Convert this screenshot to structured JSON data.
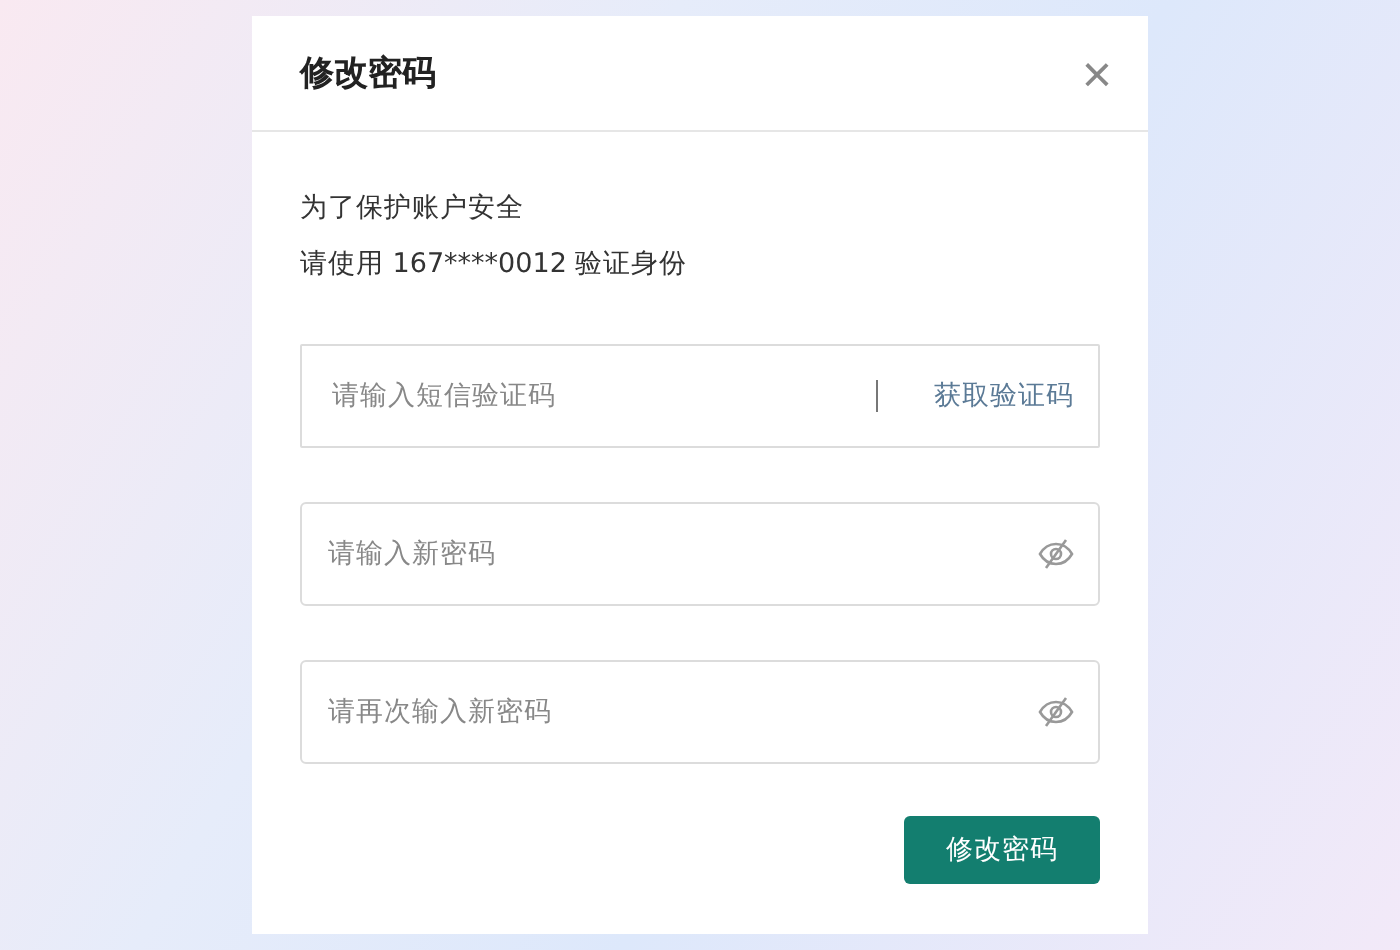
{
  "dialog": {
    "title": "修改密码",
    "close": "×"
  },
  "intro": [
    "为了保护账户安全",
    "请使用 167****0012 验证身份"
  ],
  "fields": [
    {
      "kind": "code",
      "placeholder": "请输入短信验证码",
      "action": "获取验证码"
    },
    {
      "kind": "password",
      "placeholder": "请输入新密码"
    },
    {
      "kind": "password",
      "placeholder": "请再次输入新密码"
    }
  ],
  "submit": "修改密码"
}
